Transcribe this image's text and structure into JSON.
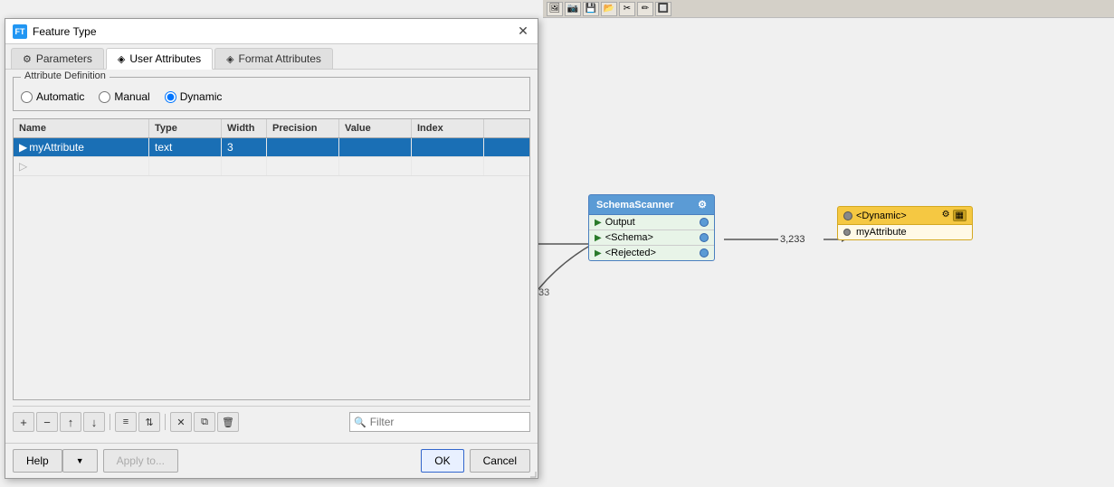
{
  "dialog": {
    "title": "Feature Type",
    "title_icon": "FT",
    "tabs": [
      {
        "id": "parameters",
        "label": "Parameters",
        "icon": "⚙",
        "active": false
      },
      {
        "id": "user-attributes",
        "label": "User Attributes",
        "icon": "◈",
        "active": true
      },
      {
        "id": "format-attributes",
        "label": "Format Attributes",
        "icon": "◈",
        "active": false
      }
    ],
    "attribute_definition": {
      "legend": "Attribute Definition",
      "options": [
        {
          "id": "automatic",
          "label": "Automatic"
        },
        {
          "id": "manual",
          "label": "Manual"
        },
        {
          "id": "dynamic",
          "label": "Dynamic",
          "selected": true
        }
      ]
    },
    "table": {
      "columns": [
        "Name",
        "Type",
        "Width",
        "Precision",
        "Value",
        "Index"
      ],
      "rows": [
        {
          "arrow": "▶",
          "name": "myAttribute",
          "type": "text",
          "width": "3",
          "precision": "",
          "value": "",
          "index": "",
          "selected": true
        }
      ],
      "empty_row": {
        "arrow": "▷"
      }
    },
    "toolbar": {
      "buttons": [
        {
          "label": "+",
          "title": "Add"
        },
        {
          "label": "−",
          "title": "Remove"
        },
        {
          "label": "↑",
          "title": "Move Up"
        },
        {
          "label": "↓",
          "title": "Move Down"
        },
        {
          "label": "≡",
          "title": "Sort"
        },
        {
          "label": "⇅",
          "title": "Reverse Sort"
        },
        {
          "label": "✕",
          "title": "Clear"
        },
        {
          "label": "⧉",
          "title": "Copy"
        },
        {
          "label": "🗑",
          "title": "Delete"
        }
      ],
      "filter_placeholder": "Filter"
    },
    "footer": {
      "help_label": "Help",
      "apply_label": "Apply to...",
      "ok_label": "OK",
      "cancel_label": "Cancel"
    }
  },
  "canvas": {
    "schema_scanner": {
      "title": "SchemaScanner",
      "ports": [
        {
          "label": "Output"
        },
        {
          "label": "<Schema>"
        },
        {
          "label": "<Rejected>"
        }
      ]
    },
    "connection_label": "3,233",
    "dynamic_node": {
      "title": "<Dynamic>",
      "attribute": "myAttribute"
    }
  },
  "top_toolbar": {
    "buttons": [
      "🖼",
      "📷",
      "💾",
      "📂",
      "✂",
      "✏",
      "🔲"
    ]
  }
}
